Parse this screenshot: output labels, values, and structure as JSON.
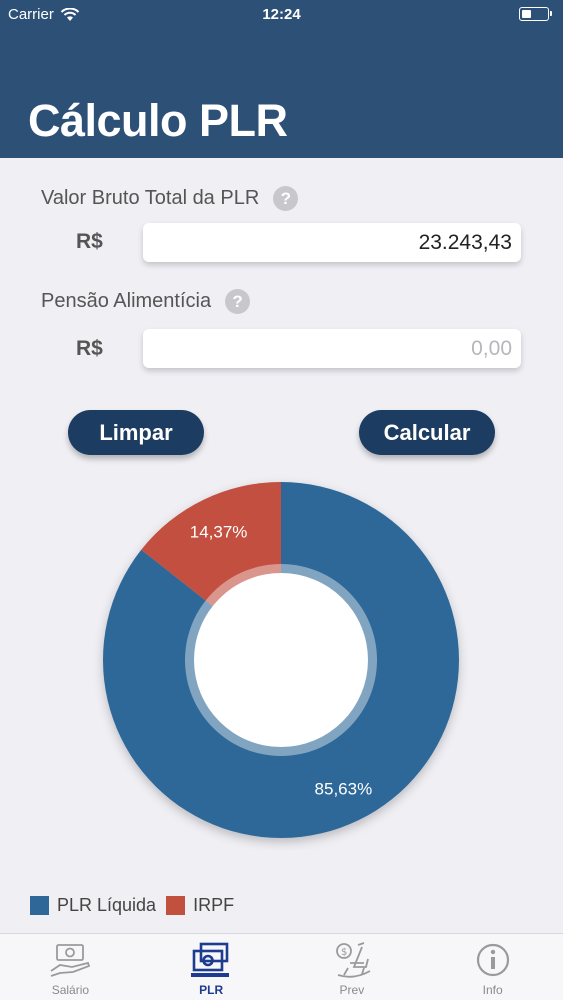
{
  "status_bar": {
    "carrier": "Carrier",
    "time": "12:24"
  },
  "header": {
    "title": "Cálculo PLR"
  },
  "form": {
    "gross_label": "Valor Bruto Total da PLR",
    "gross_currency": "R$",
    "gross_value": "23.243,43",
    "alimony_label": "Pensão Alimentícia",
    "alimony_currency": "R$",
    "alimony_placeholder": "0,00",
    "help_glyph": "?"
  },
  "buttons": {
    "clear": "Limpar",
    "calculate": "Calcular"
  },
  "chart_data": {
    "type": "pie",
    "style": "donut",
    "categories": [
      "PLR Líquida",
      "IRPF"
    ],
    "values": [
      85.63,
      14.37
    ],
    "labels": [
      "85,63%",
      "14,37%"
    ],
    "colors": [
      "#2f6898",
      "#c2503f"
    ],
    "legend": "bottom-left"
  },
  "tabs": [
    {
      "label": "Salário",
      "icon": "money-icon",
      "active": false
    },
    {
      "label": "PLR",
      "icon": "plr-money-icon",
      "active": true
    },
    {
      "label": "Prev",
      "icon": "rocking-chair-icon",
      "active": false
    },
    {
      "label": "Info",
      "icon": "info-icon",
      "active": false
    }
  ]
}
